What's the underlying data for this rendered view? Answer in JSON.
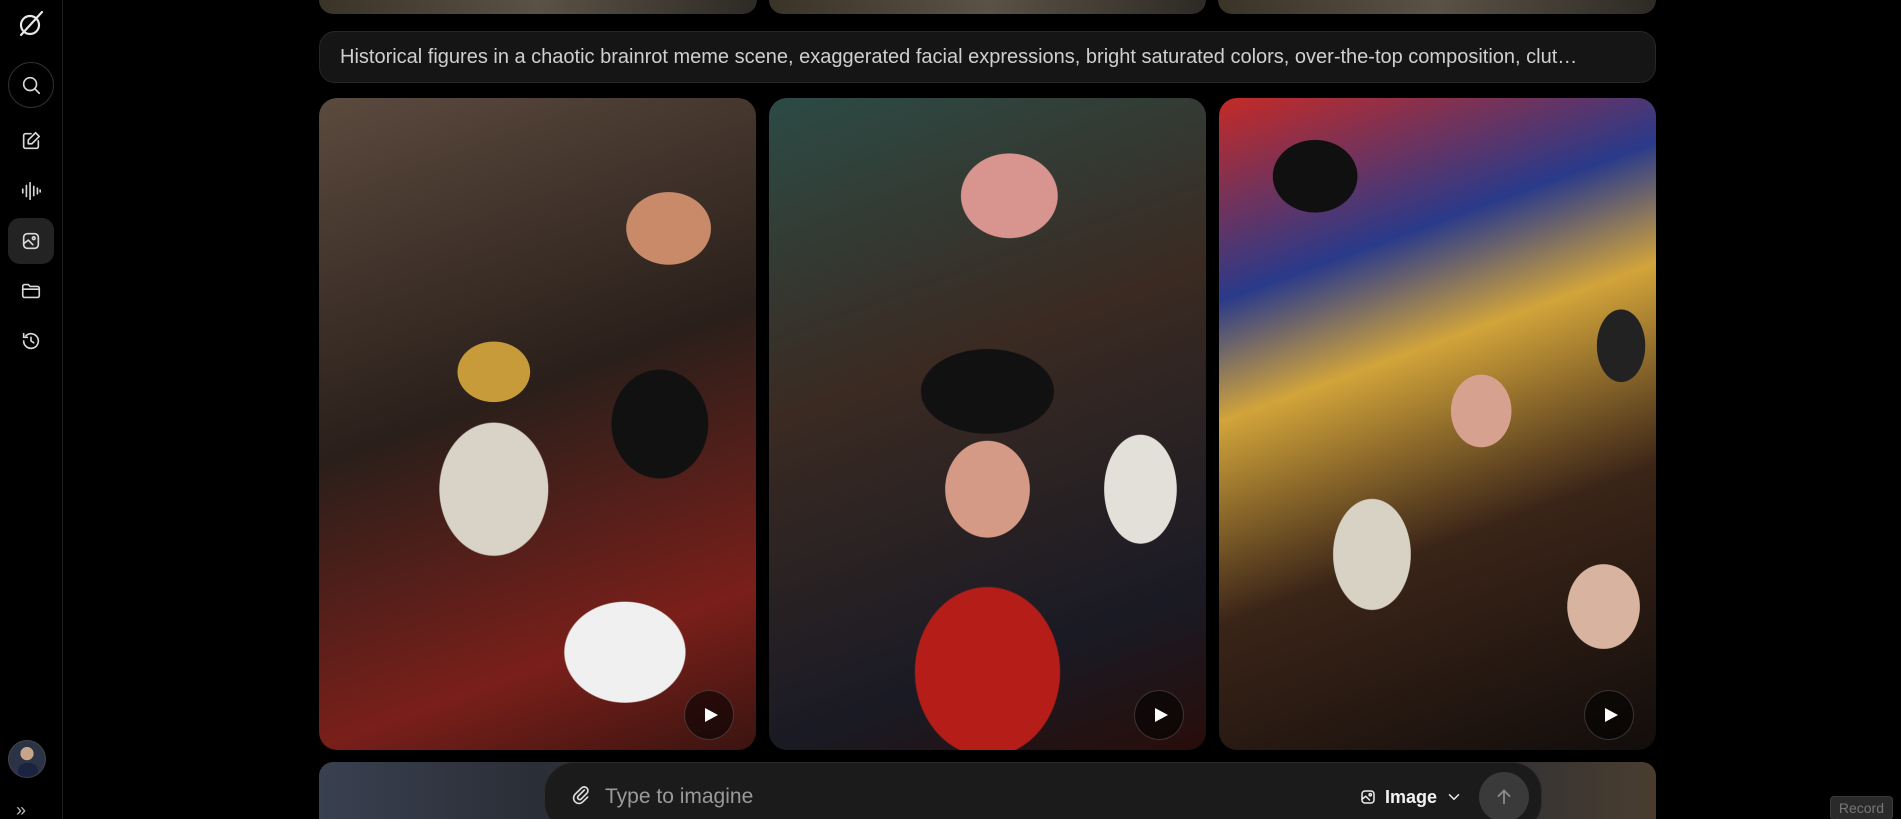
{
  "prompt": {
    "text": "Historical figures in a chaotic brainrot meme scene, exaggerated facial expressions, bright saturated colors, over-the-top composition, clut…"
  },
  "sidebar": {
    "items": [
      {
        "name": "search",
        "icon": "search-icon"
      },
      {
        "name": "new-chat",
        "icon": "edit-icon"
      },
      {
        "name": "voice",
        "icon": "waveform-icon"
      },
      {
        "name": "imagine",
        "icon": "image-sparkle-icon",
        "active": true
      },
      {
        "name": "projects",
        "icon": "folder-icon"
      },
      {
        "name": "history",
        "icon": "history-icon"
      }
    ],
    "expand_glyph": "»"
  },
  "tiles": [
    {
      "name": "kings-and-queens-crowd"
    },
    {
      "name": "colonial-officers-crowd"
    },
    {
      "name": "victorian-gentlemen-crowd"
    }
  ],
  "composer": {
    "placeholder": "Type to imagine",
    "mode_label": "Image"
  },
  "record_label": "Record"
}
